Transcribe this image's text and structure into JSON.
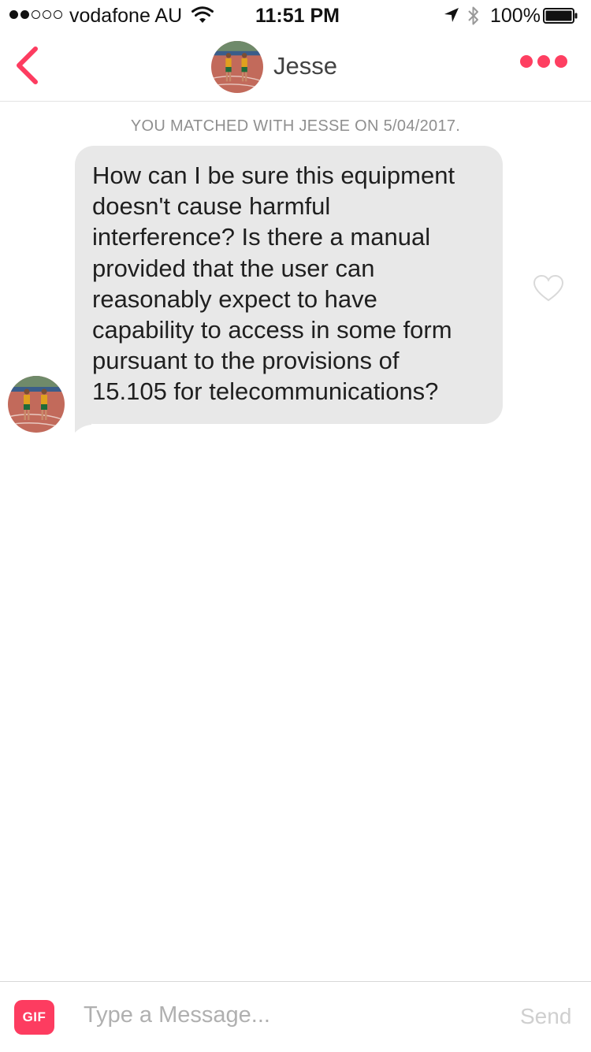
{
  "status_bar": {
    "carrier": "vodafone AU",
    "time": "11:51 PM",
    "battery_percent": "100%",
    "signal_bars_filled": 2,
    "signal_bars_total": 5,
    "icons": [
      "wifi-icon",
      "location-arrow-icon",
      "bluetooth-icon",
      "battery-icon"
    ]
  },
  "header": {
    "back_icon": "chevron-left-icon",
    "contact_name": "Jesse",
    "more_icon": "more-dots-icon"
  },
  "chat": {
    "match_note": "YOU MATCHED WITH JESSE ON 5/04/2017.",
    "messages": [
      {
        "sender": "Jesse",
        "lines": [
          "How can I be sure this equipment",
          "doesn't cause harmful",
          "interference? Is there a manual",
          "provided that the user can",
          "reasonably expect to have",
          "capability to access in some form",
          "pursuant to the provisions of",
          "15.105 for telecommunications?"
        ],
        "liked": false
      }
    ]
  },
  "input_bar": {
    "gif_label": "GIF",
    "placeholder": "Type a Message...",
    "value": "",
    "send_label": "Send"
  },
  "colors": {
    "accent": "#fd3c60",
    "bubble": "#e8e8e8",
    "muted_text": "#8f8f8f",
    "send_disabled": "#cfcfcf"
  }
}
